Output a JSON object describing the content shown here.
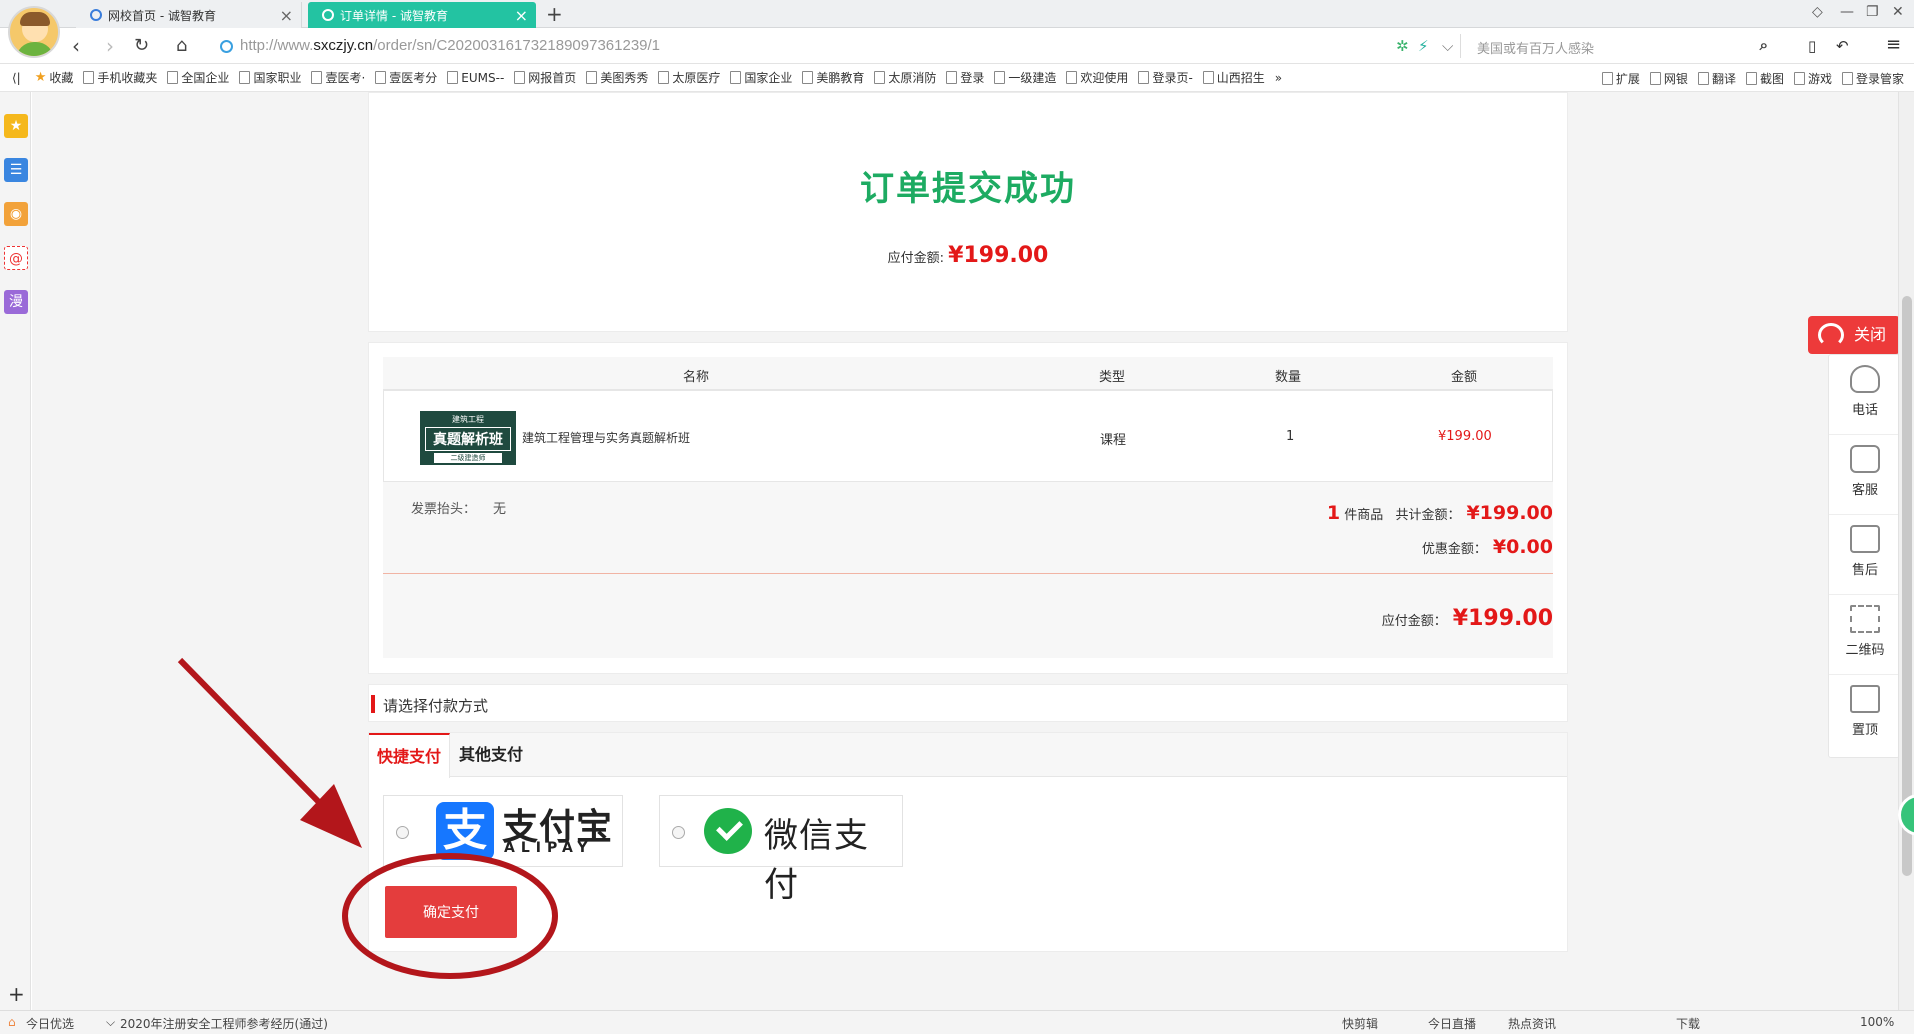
{
  "browser": {
    "tabs": [
      {
        "label": "网校首页 - 诚智教育",
        "active": false
      },
      {
        "label": "订单详情 - 诚智教育",
        "active": true
      }
    ],
    "url_prefix": "http://www.",
    "url_domain": "sxczjy.cn",
    "url_path": "/order/sn/C20200316173218909736123​9/1",
    "search_placeholder": "美国或有百万人感染",
    "bookmarks": [
      "收藏",
      "手机收藏夹",
      "全国企业",
      "国家职业",
      "壹医考·",
      "壹医考分",
      "EUMS--",
      "网报首页",
      "美图秀秀",
      "太原医疗",
      "国家企业",
      "美鹏教育",
      "太原消防",
      "登录",
      "一级建造",
      "欢迎使用",
      "登录页-",
      "山西招生"
    ],
    "bookmark_more": "»",
    "right_tools": [
      "扩展",
      "网银",
      "翻译",
      "截图",
      "游戏",
      "登录管家"
    ]
  },
  "order": {
    "title": "订单提交成功",
    "due_label": "应付金额:",
    "due_amount": "¥199.00",
    "columns": [
      "名称",
      "类型",
      "数量",
      "金额"
    ],
    "items": [
      {
        "thumb_top": "建筑工程",
        "thumb_main": "真题解析班",
        "thumb_bottom": "二级建造师",
        "name": "建筑工程管理与实务真题解析班",
        "type": "课程",
        "qty": "1",
        "price": "¥199.00"
      }
    ],
    "invoice_label": "发票抬头：",
    "invoice_value": "无",
    "count": "1",
    "count_suffix": "件商品",
    "total_label": "共计金额：",
    "total_amount": "¥199.00",
    "discount_label": "优惠金额：",
    "discount_amount": "¥0.00",
    "payable_label": "应付金额：",
    "payable_amount": "¥199.00"
  },
  "payment": {
    "heading": "请选择付款方式",
    "tabs": [
      "快捷支付",
      "其他支付"
    ],
    "alipay_logo": "支",
    "alipay_name": "支付宝",
    "alipay_sub": "ALIPAY",
    "wechat_name": "微信支付",
    "confirm": "确定支付"
  },
  "side_tools": {
    "close": "关闭",
    "items": [
      "电话",
      "客服",
      "售后",
      "二维码",
      "置顶"
    ]
  },
  "statusbar": {
    "left1": "今日优选",
    "left2": "2020年注册安全工程师参考经历(通过)",
    "right": [
      "快剪辑",
      "今日直播",
      "热点资讯",
      "下载",
      "100%"
    ]
  },
  "colors": {
    "accent_green": "#1dab62",
    "price_red": "#e31818",
    "button_red": "#e43d3d",
    "tab_teal": "#23c3a2",
    "annotation": "#b3161b"
  }
}
